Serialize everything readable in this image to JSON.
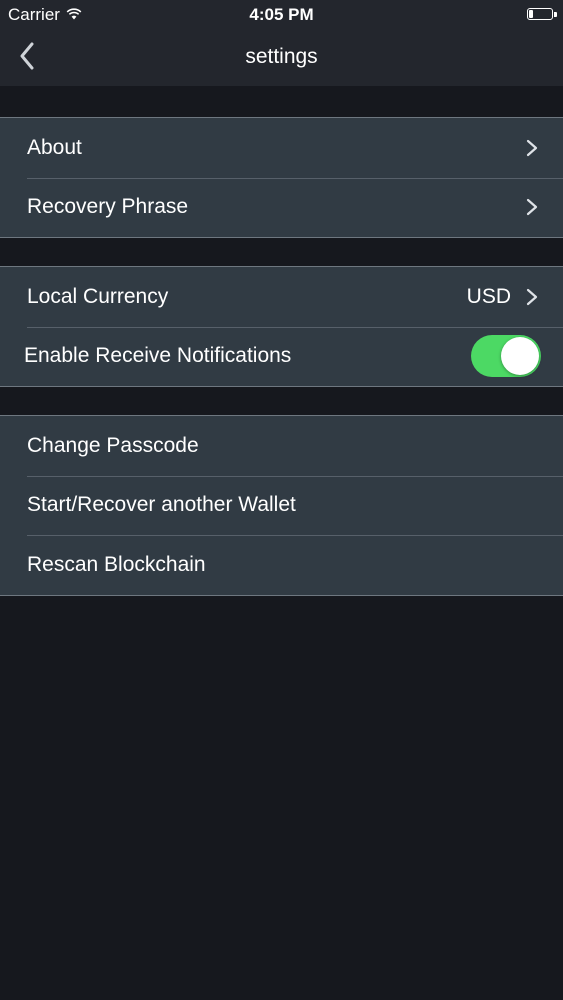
{
  "status_bar": {
    "carrier": "Carrier",
    "time": "4:05 PM",
    "wifi_icon": "wifi-icon",
    "battery_icon": "battery-icon"
  },
  "nav": {
    "title": "settings",
    "back_icon": "chevron-left-icon"
  },
  "groups": [
    {
      "rows": [
        {
          "label": "About",
          "accessory": "chevron-right-icon"
        },
        {
          "label": "Recovery Phrase",
          "accessory": "chevron-right-icon"
        }
      ]
    },
    {
      "rows": [
        {
          "label": "Local Currency",
          "value": "USD",
          "accessory": "chevron-right-icon"
        },
        {
          "label": "Enable Receive Notifications",
          "toggle_on": true
        }
      ]
    },
    {
      "rows": [
        {
          "label": "Change Passcode"
        },
        {
          "label": "Start/Recover another Wallet"
        },
        {
          "label": "Rescan Blockchain"
        }
      ]
    }
  ],
  "colors": {
    "background": "#16181e",
    "nav_bar": "#23262d",
    "cell": "#313b44",
    "toggle_on": "#4cd964"
  }
}
